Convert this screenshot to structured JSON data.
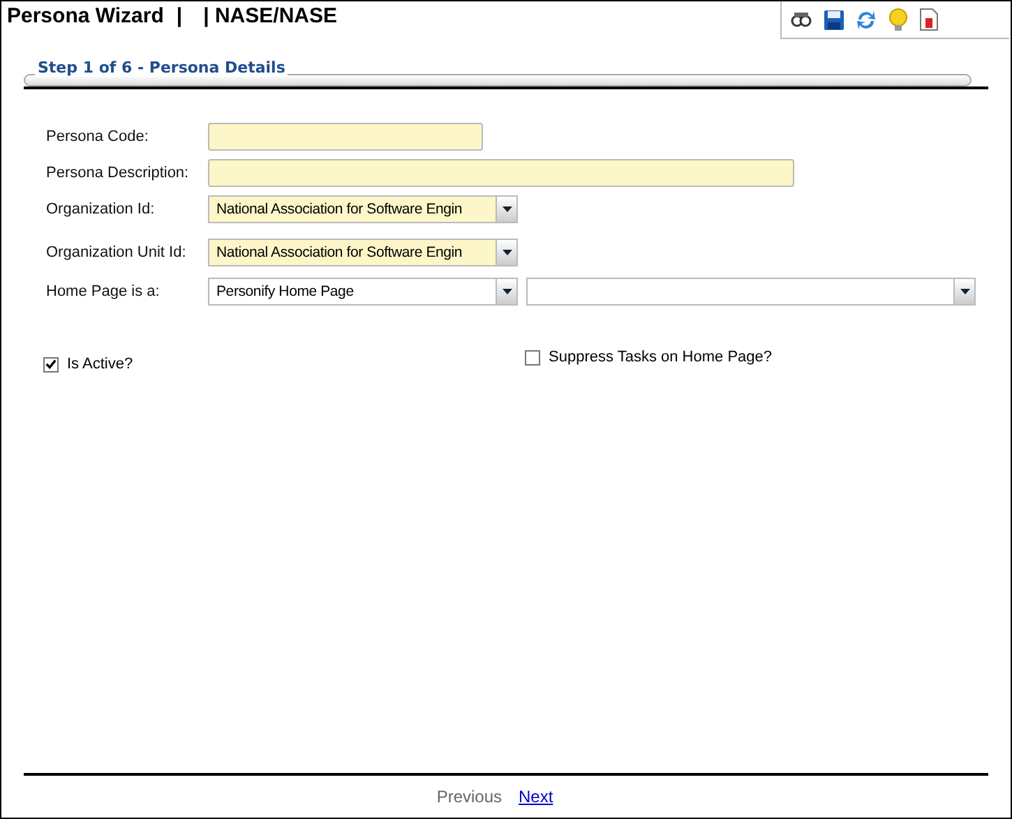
{
  "window": {
    "title": "Persona Wizard",
    "separator_1": "|",
    "context": "| NASE/NASE"
  },
  "toolbar": [
    {
      "kind": "binoculars"
    },
    {
      "kind": "save"
    },
    {
      "kind": "refresh"
    },
    {
      "kind": "bulb"
    },
    {
      "kind": "report"
    }
  ],
  "step": {
    "title": "Step 1 of 6 - Persona Details"
  },
  "fields": [
    {
      "label": "Persona Code:",
      "kind": "short_text",
      "required": true
    },
    {
      "label": "Persona Description:",
      "kind": "long_text",
      "required": true
    },
    {
      "label": "Organization Id:",
      "kind": "select",
      "value": "National Association for Software Engin",
      "required": true
    },
    {
      "label": "Organization Unit Id:",
      "kind": "select",
      "value": "National Association for Software Engin",
      "required": true
    },
    {
      "label": "Home Page is a:",
      "kind": "select2",
      "value": "Personify Home Page",
      "required": false
    }
  ],
  "checkboxes": [
    {
      "label": "Is Active?",
      "checked": true
    },
    {
      "label": "Suppress Tasks on Home Page?",
      "checked": false
    }
  ],
  "footer": [
    {
      "label": "Previous",
      "disabled": true
    },
    {
      "label": "Next",
      "disabled": false
    }
  ]
}
